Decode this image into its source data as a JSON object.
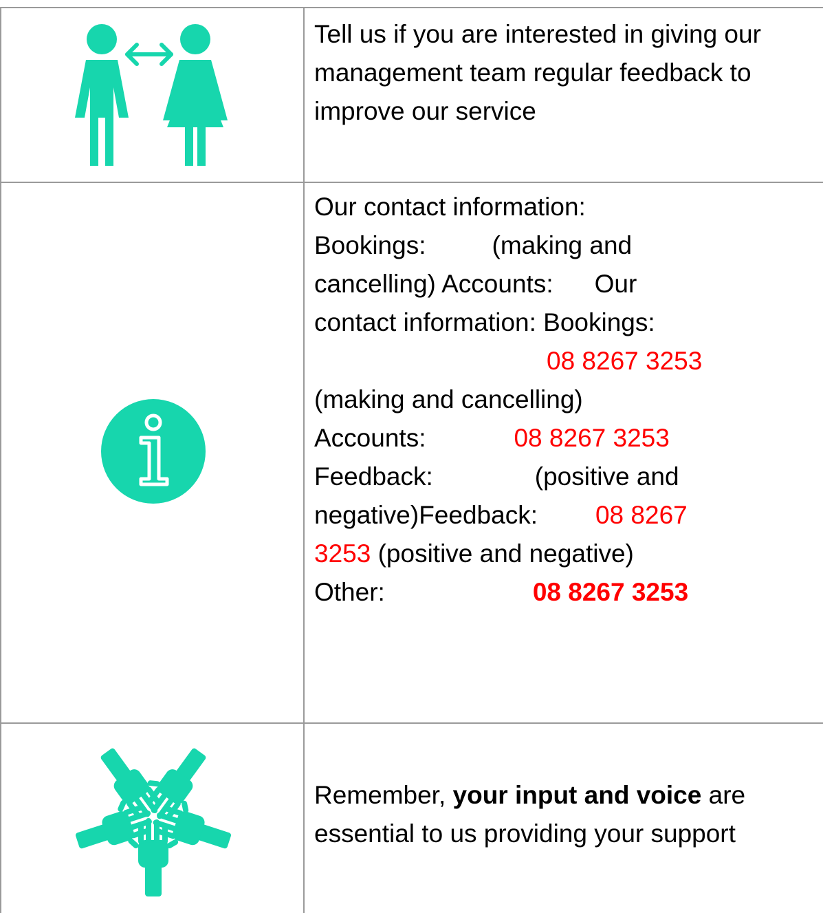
{
  "colors": {
    "accent": "#17d6ad",
    "phone": "#ff0000",
    "border": "#9a9a9a"
  },
  "rows": [
    {
      "icon": "people-exchange-icon",
      "lines": [
        "Tell us if you are interested in giving our",
        "management team regular feedback to",
        "improve our service"
      ]
    },
    {
      "icon": "info-icon",
      "line1": "Our contact information:",
      "bookings_label": "Bookings:",
      "bookings_note_a": "(making and",
      "bookings_note_b": "cancelling)",
      "accounts_inline": "Accounts:",
      "our": "Our",
      "contact_info_bookings": "contact information: Bookings:",
      "phone1": "08 8267 3253",
      "making_cancelling": "(making and cancelling)",
      "accounts_label": "Accounts:",
      "phone2": "08 8267 3253",
      "feedback_label": "Feedback:",
      "positive_and": "(positive and",
      "negative_feedback": "negative)Feedback:",
      "phone3_a": "08 8267",
      "phone3_b": "3253",
      "positive_negative": " (positive and negative)",
      "other_label": "Other:",
      "phone4": "08 8267 3253"
    },
    {
      "icon": "hands-circle-icon",
      "remember": "Remember, ",
      "emphasis": "your input and voice",
      "are": " are",
      "line2": "essential to us providing your support"
    }
  ]
}
